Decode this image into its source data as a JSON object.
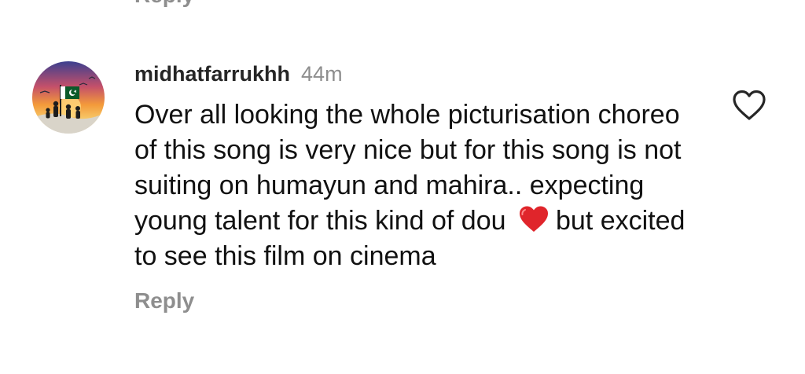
{
  "previous_comment": {
    "reply_label": "Reply"
  },
  "comment": {
    "username": "midhatfarrukhh",
    "time": "44m",
    "text_before_emoji": "Over all looking the whole picturisation choreo of this song is very nice but for this song is not suiting on humayun and mahira.. expecting young talent for this kind of dou",
    "emoji_icon": "red-heart-icon",
    "text_after_emoji": "but excited to see this film on cinema",
    "reply_label": "Reply",
    "like_icon": "heart-outline-icon",
    "avatar_icon": "pakistan-flag-sunset-avatar"
  },
  "colors": {
    "username": "#262626",
    "secondary_text": "#8e8e8e",
    "body_text": "#111111",
    "heart_emoji": "#e0252b"
  }
}
